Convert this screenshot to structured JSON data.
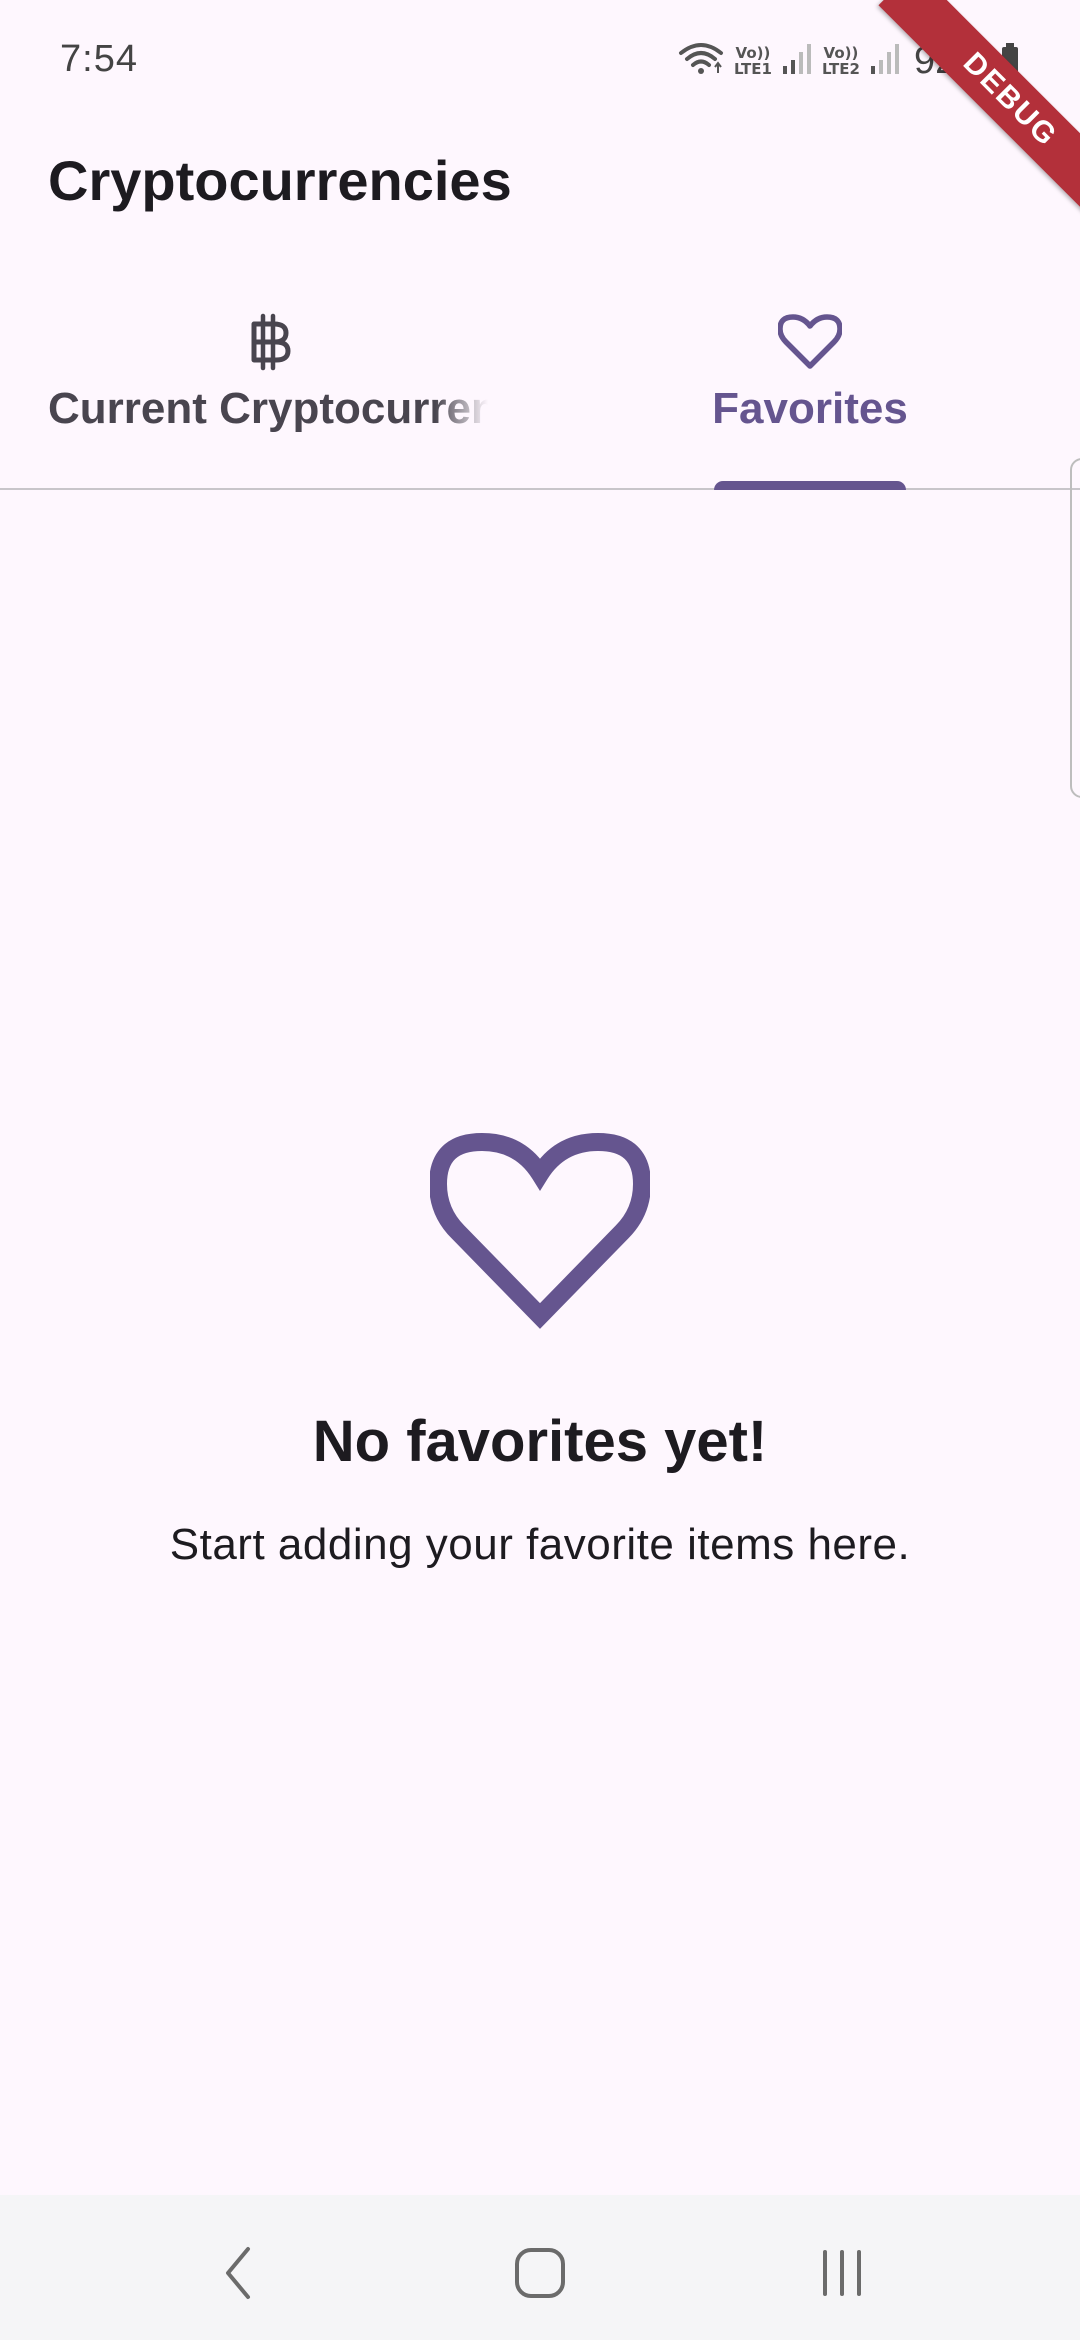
{
  "status_bar": {
    "time": "7:54",
    "sim1_label_top": "Vo))",
    "sim1_label_bottom": "LTE1",
    "sim2_label_top": "Vo))",
    "sim2_label_bottom": "LTE2",
    "battery": "92%"
  },
  "debug_banner": "DEBUG",
  "app_bar": {
    "title": "Cryptocurrencies"
  },
  "tabs": [
    {
      "label": "Current Cryptocurrencies",
      "icon": "bitcoin-icon",
      "selected": false
    },
    {
      "label": "Favorites",
      "icon": "heart-outline-icon",
      "selected": true
    }
  ],
  "empty_state": {
    "icon": "heart-outline-icon",
    "title": "No favorites yet!",
    "subtitle": "Start adding your favorite items here."
  },
  "nav_bar": {
    "buttons": [
      "back-icon",
      "home-icon",
      "recents-icon"
    ]
  },
  "colors": {
    "background": "#FEF7FE",
    "accent": "#65558F",
    "text_primary": "#1D1B20",
    "text_secondary": "#49454F",
    "debug": "#B3303A"
  }
}
